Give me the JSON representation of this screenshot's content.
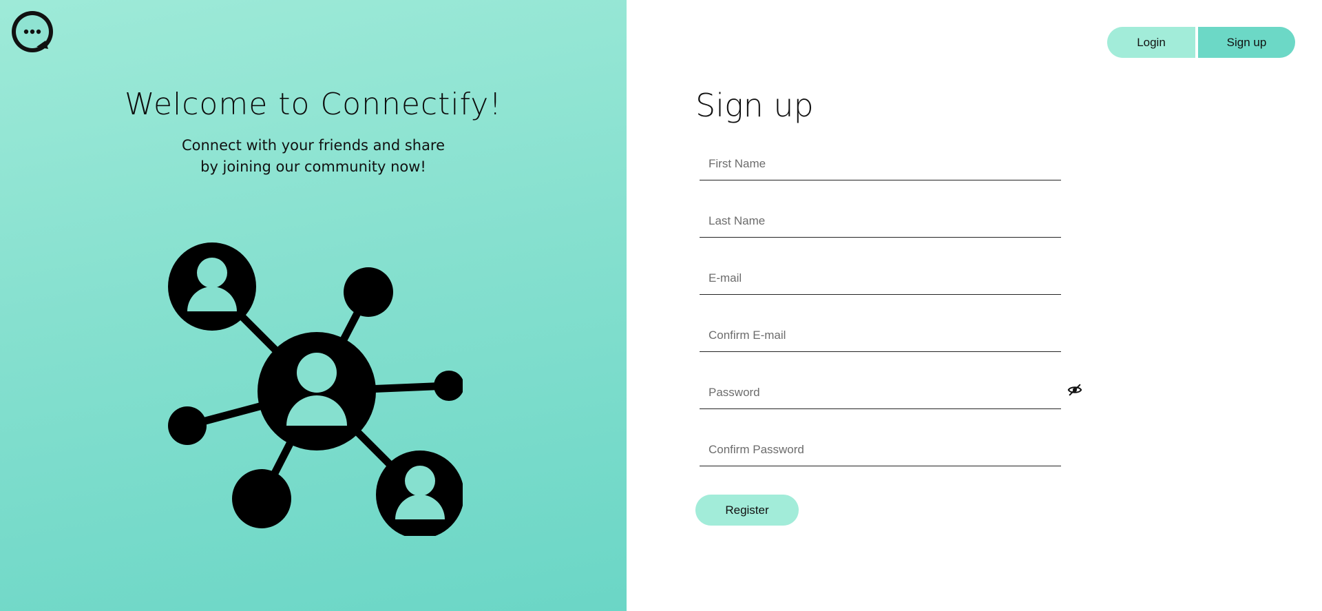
{
  "app": {
    "welcome_title": "Welcome to Connectify!",
    "welcome_line1": "Connect with your friends and share",
    "welcome_line2": "by joining our community now!"
  },
  "nav": {
    "login_label": "Login",
    "signup_label": "Sign up"
  },
  "form": {
    "title": "Sign up",
    "fields": [
      {
        "name": "first-name",
        "placeholder": "First Name",
        "value": ""
      },
      {
        "name": "last-name",
        "placeholder": "Last Name",
        "value": ""
      },
      {
        "name": "email",
        "placeholder": "E-mail",
        "value": ""
      },
      {
        "name": "confirm-email",
        "placeholder": "Confirm E-mail",
        "value": ""
      },
      {
        "name": "password",
        "placeholder": "Password",
        "value": ""
      },
      {
        "name": "confirm-password",
        "placeholder": "Confirm Password",
        "value": ""
      }
    ],
    "register_label": "Register"
  },
  "icons": {
    "logo": "chat-bubble-logo-icon",
    "illustration": "people-network-icon",
    "password_toggle": "eye-slash-icon"
  },
  "colors": {
    "accent_light": "#a2ecd9",
    "accent": "#6cd8c6",
    "panel_top": "#9eead8",
    "panel_bottom": "#6bd6c6"
  }
}
